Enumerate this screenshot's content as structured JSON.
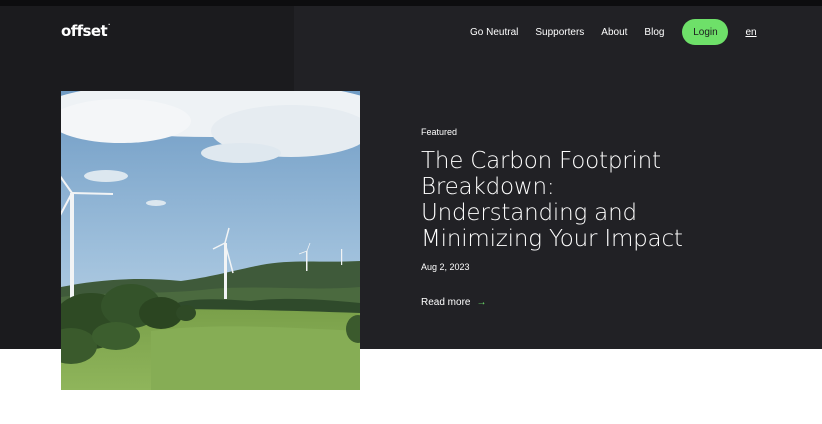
{
  "brand": {
    "name": "offset",
    "mark": "."
  },
  "nav": {
    "links": [
      "Go Neutral",
      "Supporters",
      "About",
      "Blog"
    ],
    "login_label": "Login",
    "language": "en"
  },
  "article": {
    "tag": "Featured",
    "title": "The Carbon Footprint Breakdown: Understanding and Minimizing Your Impact",
    "date": "Aug 2, 2023",
    "read_more": "Read more",
    "read_more_icon": "arrow-right-icon",
    "image": "wind-turbines-on-green-hills"
  },
  "colors": {
    "accent": "#6ee069",
    "hero_background": "#212125",
    "hero_left_panel": "#1b1b1e",
    "text": "#ffffff"
  }
}
